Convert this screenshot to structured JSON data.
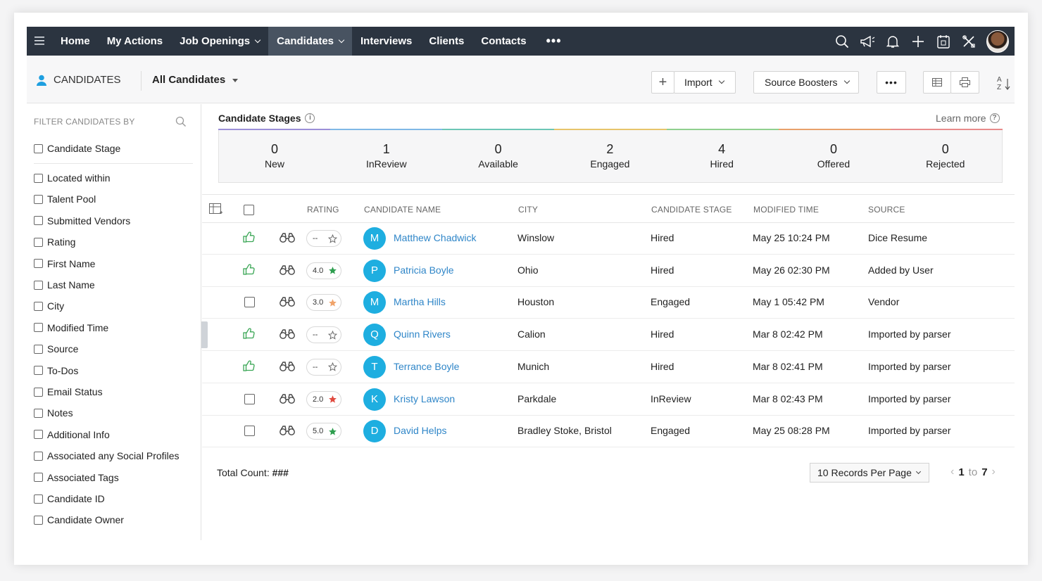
{
  "nav": {
    "items": [
      {
        "label": "Home",
        "dropdown": false,
        "active": false
      },
      {
        "label": "My Actions",
        "dropdown": false,
        "active": false
      },
      {
        "label": "Job Openings",
        "dropdown": true,
        "active": false
      },
      {
        "label": "Candidates",
        "dropdown": true,
        "active": true
      },
      {
        "label": "Interviews",
        "dropdown": false,
        "active": false
      },
      {
        "label": "Clients",
        "dropdown": false,
        "active": false
      },
      {
        "label": "Contacts",
        "dropdown": false,
        "active": false
      }
    ],
    "more": "•••",
    "icons": [
      "search-icon",
      "megaphone-icon",
      "bell-icon",
      "plus-icon",
      "calendar-icon",
      "tools-icon",
      "profile-avatar"
    ]
  },
  "header": {
    "module_title": "CANDIDATES",
    "view": "All Candidates",
    "add_symbol": "+",
    "import_label": "Import",
    "source_boosters_label": "Source Boosters",
    "more_label": "•••",
    "sort_label_top": "A",
    "sort_label_bottom": "Z"
  },
  "sidebar": {
    "title": "FILTER CANDIDATES BY",
    "top_filter": "Candidate Stage",
    "filters": [
      "Located within",
      "Talent Pool",
      "Submitted Vendors",
      "Rating",
      "First Name",
      "Last Name",
      "City",
      "Modified Time",
      "Source",
      "To-Dos",
      "Email Status",
      "Notes",
      "Additional Info",
      "Associated any Social Profiles",
      "Associated Tags",
      "Candidate ID",
      "Candidate Owner"
    ]
  },
  "stages": {
    "title": "Candidate Stages",
    "info": "i",
    "learn_more": "Learn more",
    "help": "?",
    "items": [
      {
        "count": "0",
        "label": "New"
      },
      {
        "count": "1",
        "label": "InReview"
      },
      {
        "count": "0",
        "label": "Available"
      },
      {
        "count": "2",
        "label": "Engaged"
      },
      {
        "count": "4",
        "label": "Hired"
      },
      {
        "count": "0",
        "label": "Offered"
      },
      {
        "count": "0",
        "label": "Rejected"
      }
    ],
    "bar_colors": [
      "#9b8fd8",
      "#7fb8e6",
      "#6cc6b5",
      "#e7c46b",
      "#8fd08f",
      "#e8a06b",
      "#e88b8b"
    ]
  },
  "table": {
    "columns": {
      "rating": "RATING",
      "name": "CANDIDATE NAME",
      "city": "CITY",
      "stage": "CANDIDATE STAGE",
      "modified": "MODIFIED TIME",
      "source": "SOURCE"
    },
    "rows": [
      {
        "qualified": true,
        "rating": "--",
        "star_color": "#666666",
        "star_filled": false,
        "initial": "M",
        "name": "Matthew Chadwick",
        "city": "Winslow",
        "stage": "Hired",
        "modified": "May 25 10:24 PM",
        "source": "Dice Resume"
      },
      {
        "qualified": true,
        "rating": "4.0",
        "star_color": "#2e9e4f",
        "star_filled": true,
        "initial": "P",
        "name": "Patricia Boyle",
        "city": "Ohio",
        "stage": "Hired",
        "modified": "May 26 02:30 PM",
        "source": "Added by User"
      },
      {
        "qualified": false,
        "rating": "3.0",
        "star_color": "#f0a36a",
        "star_filled": true,
        "initial": "M",
        "name": "Martha Hills",
        "city": "Houston",
        "stage": "Engaged",
        "modified": "May 1 05:42 PM",
        "source": "Vendor"
      },
      {
        "qualified": true,
        "rating": "--",
        "star_color": "#666666",
        "star_filled": false,
        "initial": "Q",
        "name": "Quinn Rivers",
        "city": "Calion",
        "stage": "Hired",
        "modified": "Mar 8 02:42 PM",
        "source": "Imported by parser"
      },
      {
        "qualified": true,
        "rating": "--",
        "star_color": "#666666",
        "star_filled": false,
        "initial": "T",
        "name": "Terrance Boyle",
        "city": "Munich",
        "stage": "Hired",
        "modified": "Mar 8 02:41 PM",
        "source": "Imported by parser"
      },
      {
        "qualified": false,
        "rating": "2.0",
        "star_color": "#e04a3f",
        "star_filled": true,
        "initial": "K",
        "name": "Kristy Lawson",
        "city": "Parkdale",
        "stage": "InReview",
        "modified": "Mar 8 02:43 PM",
        "source": "Imported by parser"
      },
      {
        "qualified": false,
        "rating": "5.0",
        "star_color": "#2e9e4f",
        "star_filled": true,
        "initial": "D",
        "name": "David Helps",
        "city": "Bradley Stoke, Bristol",
        "stage": "Engaged",
        "modified": "May 25 08:28 PM",
        "source": "Imported by parser"
      }
    ]
  },
  "footer": {
    "total_label": "Total Count:",
    "total_value": "###",
    "per_page": "10 Records Per Page",
    "page_from": "1",
    "page_to_word": "to",
    "page_to": "7"
  }
}
